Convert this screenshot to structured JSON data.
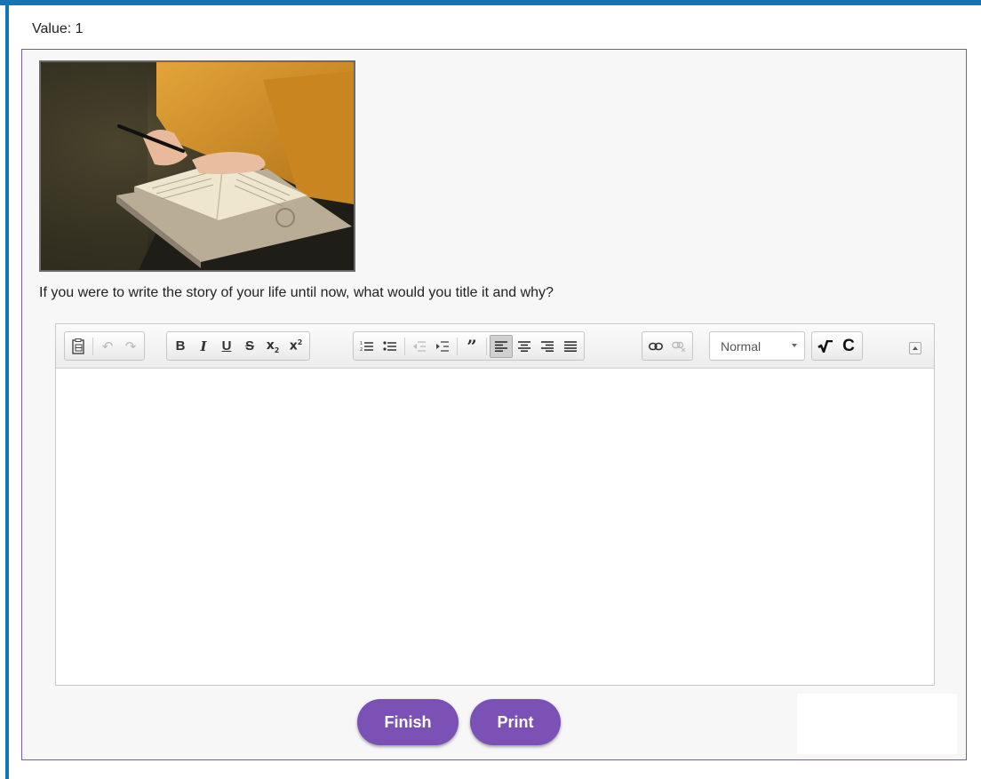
{
  "value_label": "Value: 1",
  "question": "If you were to write the story of your life until now, what would you title it and why?",
  "editor": {
    "format_select": "Normal",
    "content": ""
  },
  "buttons": {
    "finish": "Finish",
    "print": "Print"
  },
  "colors": {
    "frame_accent": "#1474b8",
    "panel_border": "#7a5aa8",
    "button_purple": "#7b51b5"
  },
  "toolbar_icons": [
    "paste-icon",
    "undo-icon",
    "redo-icon",
    "bold-icon",
    "italic-icon",
    "underline-icon",
    "strikethrough-icon",
    "subscript-icon",
    "superscript-icon",
    "numbered-list-icon",
    "bulleted-list-icon",
    "outdent-icon",
    "indent-icon",
    "blockquote-icon",
    "align-left-icon",
    "align-center-icon",
    "align-right-icon",
    "justify-icon",
    "link-icon",
    "unlink-icon",
    "math-sqrt-icon",
    "chemistry-icon"
  ]
}
